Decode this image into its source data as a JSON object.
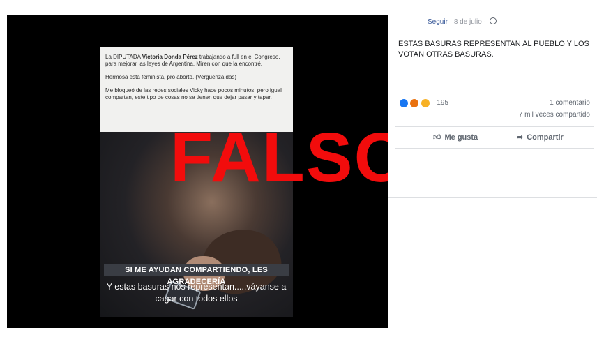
{
  "image": {
    "card": {
      "line1_pre": "La DIPUTADA ",
      "line1_bold": "Victoria Donda Pérez",
      "line1_post": " trabajando a full en el Congreso, para mejorar las leyes de Argentina. Miren con que la encontré.",
      "paragraph2": "Hermosa esta feminista, pro aborto. (Vergüenza das)",
      "paragraph3": "Me bloqueó de las redes sociales Vicky hace pocos minutos, pero igual compartan, este tipo de cosas no se tienen que dejar pasar y tapar.",
      "banner": "SI ME AYUDAN COMPARTIENDO, LES AGRADECERÍA",
      "caption": "Y estas basuras nos representan.....váyanse a cagar con todos ellos"
    },
    "stamp": "FALSO"
  },
  "post": {
    "follow": "Seguir",
    "separator": "·",
    "date": "8 de julio",
    "text": "ESTAS BASURAS REPRESENTAN AL PUEBLO Y LOS VOTAN OTRAS BASURAS.",
    "reaction_count": "195",
    "comments": "1 comentario",
    "shares": "7 mil veces compartido",
    "like_label": "Me gusta",
    "share_label": "Compartir"
  }
}
